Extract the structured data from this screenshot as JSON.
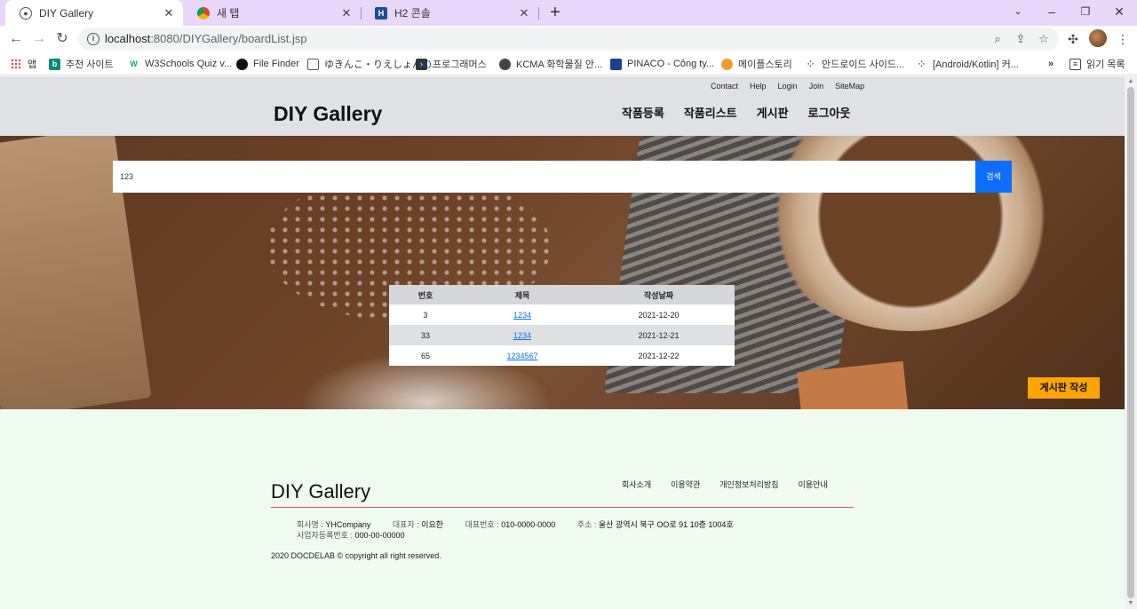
{
  "browser": {
    "tabs": [
      {
        "title": "DIY Gallery",
        "active": true,
        "icon": "globe-icon"
      },
      {
        "title": "새 탭",
        "active": false,
        "icon": "chrome-icon"
      },
      {
        "title": "H2 콘솔",
        "active": false,
        "icon": "h2-icon"
      }
    ],
    "url_host": "localhost",
    "url_path": ":8080/DIYGallery/boardList.jsp",
    "bookmarks": [
      {
        "label": "앱",
        "icon": "apps-grid-icon"
      },
      {
        "label": "추천 사이트",
        "icon": "bing-icon"
      },
      {
        "label": "W3Schools Quiz v...",
        "icon": "w3schools-icon"
      },
      {
        "label": "File Finder",
        "icon": "github-icon"
      },
      {
        "label": "ゆきんこ・りえしょんの...",
        "icon": "tv-icon"
      },
      {
        "label": "프로그래머스",
        "icon": "programmers-icon"
      },
      {
        "label": "KCMA 화학물질 안...",
        "icon": "globe-icon"
      },
      {
        "label": "PINACO - Công ty...",
        "icon": "pinaco-icon"
      },
      {
        "label": "메이플스토리",
        "icon": "maple-icon"
      },
      {
        "label": "안드로이드 사이드...",
        "icon": "dots-icon"
      },
      {
        "label": "[Android/Kotlin] 커...",
        "icon": "dots-icon"
      }
    ],
    "reading_list": "읽기 목록",
    "more": "»"
  },
  "header": {
    "util_links": [
      "Contact",
      "Help",
      "Login",
      "Join",
      "SiteMap"
    ],
    "logo": "DIY Gallery",
    "nav": [
      "작품등록",
      "작품리스트",
      "게시판",
      "로그아웃"
    ]
  },
  "search": {
    "value": "123",
    "button": "검색"
  },
  "board": {
    "headers": [
      "번호",
      "제목",
      "작성날짜"
    ],
    "rows": [
      {
        "no": "3",
        "title": "1234",
        "date": "2021-12-20"
      },
      {
        "no": "33",
        "title": "1234",
        "date": "2021-12-21"
      },
      {
        "no": "65",
        "title": "1234567",
        "date": "2021-12-22"
      }
    ],
    "write_button": "게시판 작성"
  },
  "footer": {
    "logo": "DIY Gallery",
    "links": [
      "회사소개",
      "이용약관",
      "개인정보처리방침",
      "이용안내"
    ],
    "company_label": "회사명 : ",
    "company": "YHCompany",
    "ceo_label": "대표자 : ",
    "ceo": "이요한",
    "phone_label": "대표번호 : ",
    "phone": "010-0000-0000",
    "address_label": "주소 : ",
    "address": "울산 광역시 북구 OO로 91 10층 1004호",
    "bizno_label": "사업자등록번호 : ",
    "bizno": "000-00-00000",
    "copyright": "2020 DOCDELAB © copyright all right reserved."
  },
  "colors": {
    "search_button": "#0d6efd",
    "write_button": "#ffa500",
    "footer_bg": "#f0fbef",
    "footer_line": "#e2534a",
    "tabbar": "#e8d6fb"
  }
}
